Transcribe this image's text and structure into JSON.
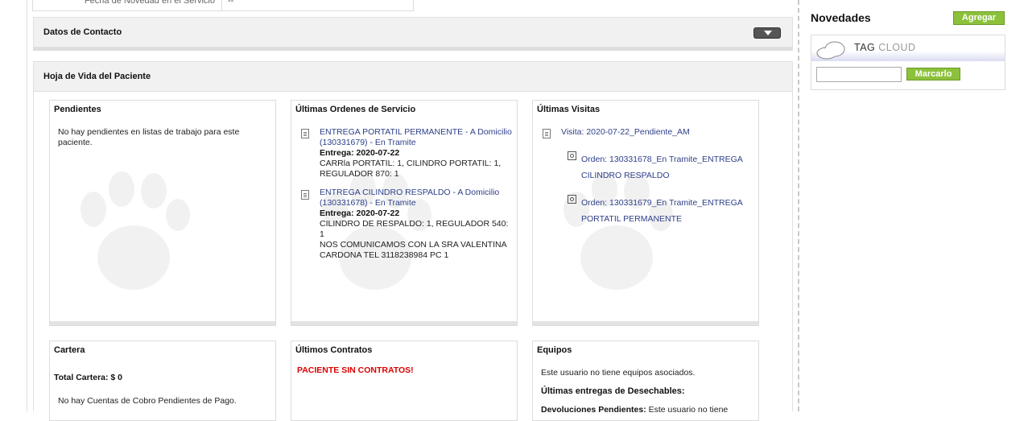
{
  "top_field": {
    "label": "Fecha de Novedad en el Servicio",
    "value": "--"
  },
  "panels": {
    "contacto": "Datos de Contacto",
    "hoja": "Hoja de Vida del Paciente"
  },
  "pendientes": {
    "title": "Pendientes",
    "empty_line1": "No hay pendientes en listas de trabajo para este",
    "empty_line2": "paciente."
  },
  "ordenes": {
    "title": "Últimas Ordenes de Servicio",
    "items": [
      {
        "line1": "ENTREGA PORTATIL PERMANENTE - A Domicilio",
        "line2": "(130331679) - En Tramite",
        "entrega": "Entrega: 2020-07-22",
        "det1": "CARRla PORTATIL: 1, CILINDRO PORTATIL: 1,",
        "det2": "REGULADOR 870: 1"
      },
      {
        "line1": "ENTREGA CILINDRO RESPALDO - A Domicilio",
        "line2": "(130331678) - En Tramite",
        "entrega": "Entrega: 2020-07-22",
        "det1": "CILINDRO DE RESPALDO: 1, REGULADOR 540:",
        "det2": "1",
        "det3": "NOS COMUNICAMOS CON LA SRA VALENTINA",
        "det4": "CARDONA TEL 3118238984 PC 1"
      }
    ]
  },
  "visitas": {
    "title": "Últimas Visitas",
    "visit": "Visita: 2020-07-22_Pendiente_AM",
    "orders": [
      {
        "line1": "Orden: 130331678_En Tramite_ENTREGA",
        "line2": "CILINDRO RESPALDO"
      },
      {
        "line1": "Orden: 130331679_En Tramite_ENTREGA",
        "line2": "PORTATIL PERMANENTE"
      }
    ]
  },
  "cartera": {
    "title": "Cartera",
    "total": "Total Cartera: $ 0",
    "empty": "No hay Cuentas de Cobro Pendientes de Pago."
  },
  "contratos": {
    "title": "Últimos Contratos",
    "empty": "PACIENTE SIN CONTRATOS!",
    "empty_color": "#dd0000"
  },
  "equipos": {
    "title": "Equipos",
    "empty": "Este usuario no tiene equipos asociados.",
    "desechables": "Últimas entregas de Desechables:",
    "devoluciones_label": "Devoluciones Pendientes:",
    "devoluciones_text": "Este usuario no tiene"
  },
  "novedades": {
    "title": "Novedades",
    "add_button": "Agregar"
  },
  "tag_cloud": {
    "tag": "TAG",
    "cloud": "CLOUD",
    "input_value": "",
    "button": "Marcarlo"
  },
  "colors": {
    "accent_green": "#8cc13b",
    "link": "#2d3f8a"
  }
}
